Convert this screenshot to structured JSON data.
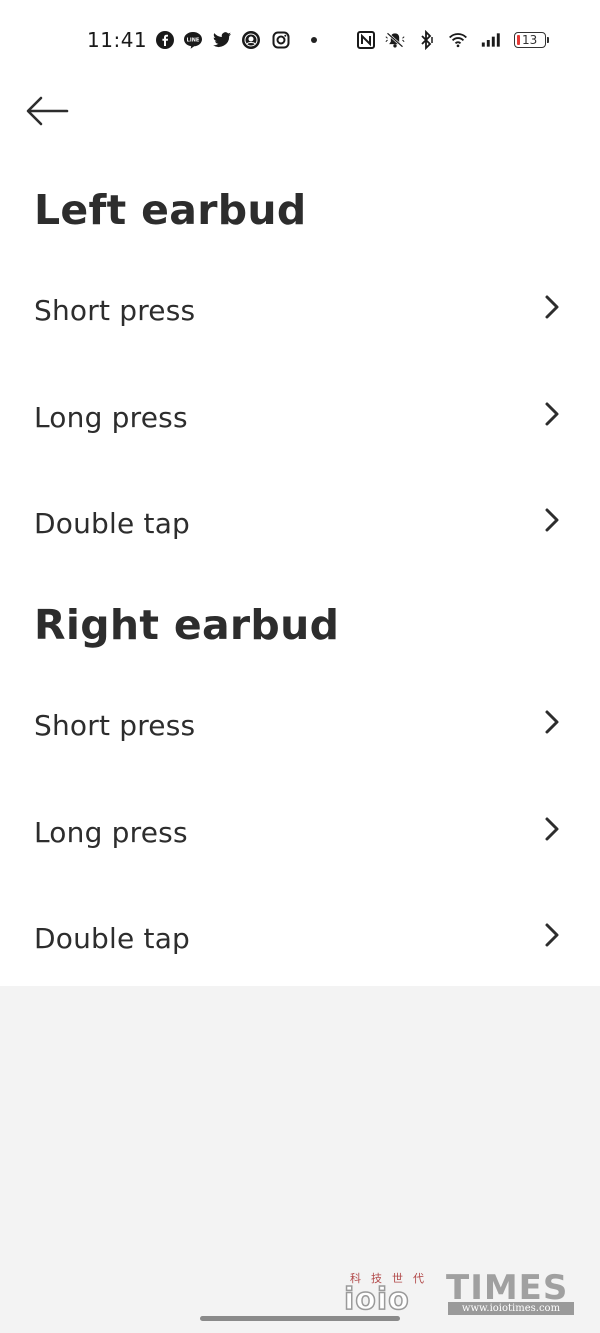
{
  "status_bar": {
    "time": "11:41",
    "battery_level": "13",
    "left_icons": [
      "facebook-icon",
      "line-icon",
      "twitter-icon",
      "starbucks-icon",
      "instagram-icon"
    ],
    "right_icons": [
      "nfc-icon",
      "mute-icon",
      "bluetooth-icon",
      "wifi-icon",
      "signal-icon",
      "battery-icon"
    ],
    "battery_color": "#e53935"
  },
  "sections": [
    {
      "title": "Left earbud",
      "items": [
        {
          "label": "Short press"
        },
        {
          "label": "Long press"
        },
        {
          "label": "Double tap"
        }
      ]
    },
    {
      "title": "Right earbud",
      "items": [
        {
          "label": "Short press"
        },
        {
          "label": "Long press"
        },
        {
          "label": "Double tap"
        }
      ]
    }
  ],
  "watermark": {
    "chinese": "科技世代",
    "logo": "ioio",
    "brand": "TIMES",
    "url": "www.ioiotimes.com"
  },
  "colors": {
    "background": "#ffffff",
    "lower_background": "#f3f3f3",
    "text": "#2d2d2d"
  }
}
